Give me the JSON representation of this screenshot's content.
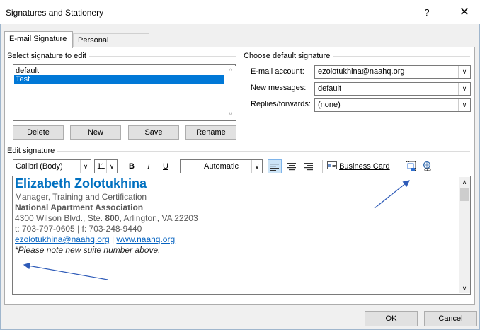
{
  "window": {
    "title": "Signatures and Stationery",
    "help_label": "?",
    "close_label": "✕"
  },
  "tabs": [
    {
      "label": "E-mail Signature",
      "active": true
    },
    {
      "label": "Personal Stationery",
      "active": false
    }
  ],
  "select_signature": {
    "group_label": "Select signature to edit",
    "items": [
      {
        "label": "default",
        "selected": false
      },
      {
        "label": "Test",
        "selected": true
      }
    ],
    "buttons": {
      "delete": "Delete",
      "new": "New",
      "save": "Save",
      "rename": "Rename"
    }
  },
  "default_signature": {
    "group_label": "Choose default signature",
    "email_account_label": "E-mail account:",
    "email_account_value": "ezolotukhina@naahq.org",
    "new_messages_label": "New messages:",
    "new_messages_value": "default",
    "replies_label": "Replies/forwards:",
    "replies_value": "(none)"
  },
  "edit_signature": {
    "group_label": "Edit signature",
    "toolbar": {
      "font": "Calibri (Body)",
      "size": "11",
      "bold": "B",
      "italic": "I",
      "underline": "U",
      "color": "Automatic",
      "business_card": "Business Card"
    },
    "content": {
      "name": "Elizabeth Zolotukhina",
      "title": "Manager, Training and Certification",
      "org": "National Apartment Association",
      "address_pre": "4300 Wilson Blvd., Ste. ",
      "address_suite": "800",
      "address_post": ", Arlington, VA 22203",
      "phone": "t: 703-797-0605 | f: 703-248-9440",
      "email": "ezolotukhina@naahq.org",
      "link_sep": " | ",
      "website": "www.naahq.org",
      "note": "*Please note new suite number above."
    }
  },
  "footer": {
    "ok": "OK",
    "cancel": "Cancel"
  },
  "colors": {
    "accent": "#0078d7",
    "name_blue": "#0070c0",
    "link": "#0563c1",
    "arrow": "#2e5bb8"
  },
  "icons": {
    "insert_picture": "insert-picture-icon",
    "hyperlink": "hyperlink-icon",
    "business_card": "business-card-icon"
  }
}
